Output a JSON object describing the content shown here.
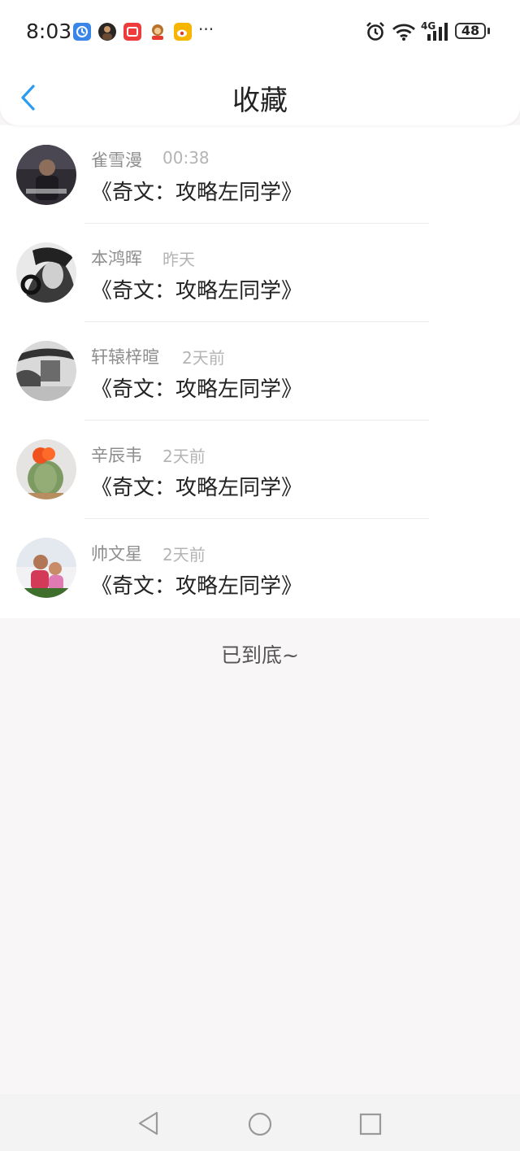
{
  "status_bar": {
    "time": "8:03",
    "network": "4G",
    "battery": "48",
    "overflow": "···",
    "notification_icons": [
      "clock-app-icon",
      "avatar-app-icon",
      "red-app-icon",
      "monkey-app-icon",
      "weibo-icon"
    ],
    "system_icons": [
      "alarm-icon",
      "wifi-icon",
      "signal-icon",
      "battery-icon"
    ]
  },
  "header": {
    "title": "收藏",
    "back_icon": "back-arrow-icon",
    "accent_color": "#2b9cf2"
  },
  "favorites": [
    {
      "name": "雀雪漫",
      "time": "00:38",
      "book": "《奇文：攻略左同学》"
    },
    {
      "name": "本鸿晖",
      "time": "昨天",
      "book": "《奇文：攻略左同学》"
    },
    {
      "name": "轩辕梓暄",
      "time": "2天前",
      "book": "《奇文：攻略左同学》"
    },
    {
      "name": "辛辰韦",
      "time": "2天前",
      "book": "《奇文：攻略左同学》"
    },
    {
      "name": "帅文星",
      "time": "2天前",
      "book": "《奇文：攻略左同学》"
    }
  ],
  "footer": {
    "end_text": "已到底~"
  },
  "nav_bar": {
    "buttons": [
      "back-triangle-icon",
      "home-circle-icon",
      "recents-square-icon"
    ]
  }
}
